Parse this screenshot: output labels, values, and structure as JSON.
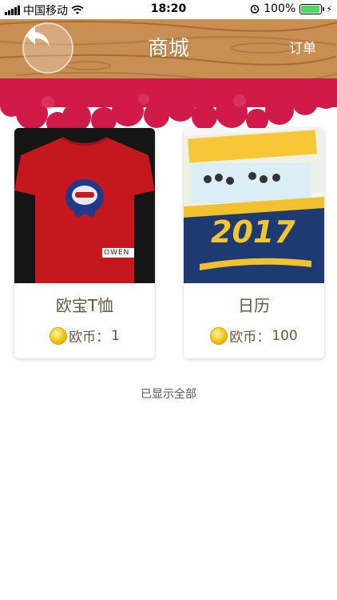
{
  "status_bar": {
    "carrier": "中国移动",
    "time": "18:20",
    "battery_percent": "100%"
  },
  "header": {
    "title": "商城",
    "orders_label": "订单",
    "back_icon": "back-arrow-icon"
  },
  "products": [
    {
      "name": "欧宝T恤",
      "price_label": "欧币：",
      "price_value": "1"
    },
    {
      "name": "日历",
      "price_label": "欧币：",
      "price_value": "100"
    }
  ],
  "calendar_year": "2017",
  "shirt_tag": "OWEN",
  "footer_note": "已显示全部",
  "colors": {
    "wood": "#c98e52",
    "cloud_red": "#d01a48",
    "text_brown": "#6b5540",
    "coin_gold": "#f1c40f"
  }
}
